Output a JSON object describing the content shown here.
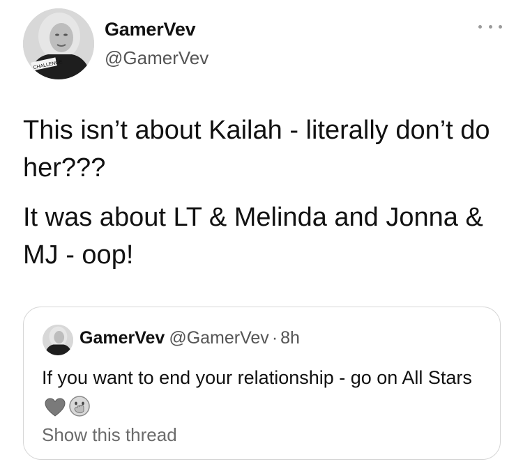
{
  "author": {
    "display_name": "GamerVev",
    "handle": "@GamerVev",
    "avatar_icon": "profile-photo",
    "avatar_lettering": "CHALLENGE"
  },
  "menu": {
    "icon": "more-options-icon"
  },
  "tweet": {
    "paragraphs": [
      "This isn’t about Kailah - literally don’t do her???",
      "It was about LT & Melinda and Jonna & MJ - oop!"
    ]
  },
  "quoted_tweet": {
    "display_name": "GamerVev",
    "handle": "@GamerVev",
    "separator": "·",
    "time": "8h",
    "text": "If you want to end your relationship - go on All Stars",
    "emojis": [
      "heart-icon",
      "face-with-hand-over-mouth-icon"
    ],
    "show_thread_label": "Show this thread"
  }
}
